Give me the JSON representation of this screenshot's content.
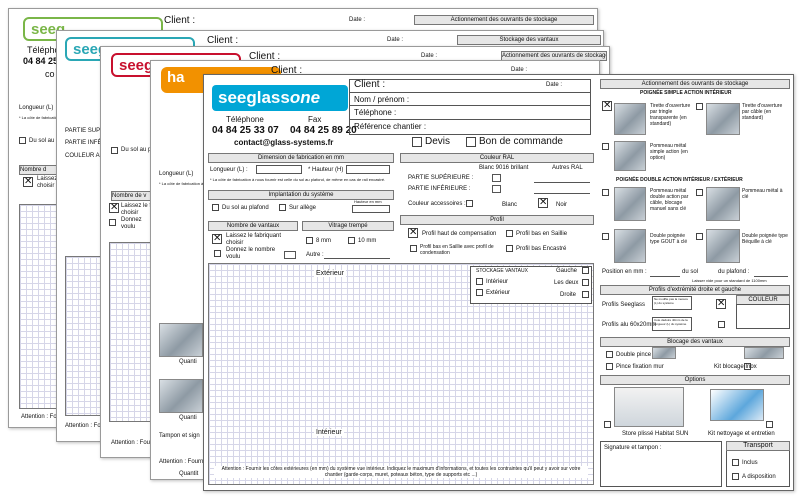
{
  "brand": {
    "name_a": "seeglass",
    "name_b": "ONE",
    "other_logo_1": "seeg",
    "other_logo_2": "seeg",
    "other_logo_3": "ha",
    "phone_label": "Téléphone",
    "phone": "04 84 25 33 07",
    "fax_label": "Fax",
    "fax": "04 84 25 89 20",
    "email": "contact@glass-systems.fr",
    "back_phone_label": "Téléph",
    "back_phone": "04 84 25 3",
    "back_contact": "contact",
    "back_phone_label_2": "Téléphon",
    "back_phone_2": "04 84 25 33",
    "back_contact_2": "contact@",
    "back_phone_label_3": "Télépho",
    "back_phone_3": "04 84 25 33",
    "back_contact_3": "conta",
    "back_phone_label_4": "Téléphon",
    "back_phone_4": "04 84 25 33",
    "back_contact_4": "contact@g",
    "back_phone_label_5": "Téléphone",
    "back_phone_5": "04 84 25 33 0",
    "back_contact_5": "co"
  },
  "back_sheets": {
    "client": "Client :",
    "date": "Date :",
    "title_1": "Actionnement des ouvrants de stockage",
    "title_2": "Stockage des vantaux",
    "title_3": "Actionnement des ouvrants de stockage",
    "title_4": "Couleur RAL",
    "longueur": "Longueur (L)",
    "cote_note": "* La côte de fabrication à nous",
    "du_sol": "Du sol au pla",
    "nombre": "Nombre d",
    "laissez": "Laissez le fabri",
    "choisir": "choisir",
    "attention": "Attention : Fo",
    "partie_sup": "PARTIE SUPÉ",
    "partie_inf": "PARTIE INFÉRI",
    "couleur_ac": "COULEUR AC",
    "du_sol_2": "Du sol au pl",
    "du": "Du",
    "longueur_2": "Longueur (L)",
    "cote_note_2": "* La côte de fabrication à nous",
    "nombre_2": "Nombre de v",
    "laissez_2": "Laissez le fab",
    "choisir_2": "choisir",
    "donnez": "Donnez",
    "voulu": "voulu",
    "attention_2": "Attention : Fo",
    "longueur_3": "Longueur (L)",
    "quanti": "Quanti",
    "attention_3": "Attention : Fourni",
    "quanti_2": "Quanti",
    "tampon": "Tampon et sign",
    "attention_4": "Attention : Fourn",
    "quantit": "Quantit"
  },
  "header": {
    "client": "Client :",
    "date": "Date :",
    "nom": "Nom / prénom :",
    "telephone": "Téléphone :",
    "reference": "Référence chantier :",
    "devis": "Devis",
    "bon": "Bon de commande"
  },
  "dimension": {
    "title": "Dimension de fabrication en mm",
    "longueur": "Longueur (L) :",
    "hauteur": "* Hauteur (H)",
    "note": "* La côte de fabrication à nous fournir est celle du sol au plafond, de même en cas de rail encastré."
  },
  "implantation": {
    "title": "Implantation du système",
    "sol_plafond": "Du sol au plafond",
    "allege": "Sur allège",
    "hauteur_allege": "Hauteur en mm"
  },
  "vantaux": {
    "title": "Nombre de vantaux",
    "laissez": "Laissez le fabriquant choisir",
    "donnez": "Donnez le nombre voulu"
  },
  "vitrage": {
    "title": "Vitrage trempé",
    "opt1": "8 mm",
    "opt2": "10 mm",
    "autre": "Autre :"
  },
  "couleur": {
    "title": "Couleur RAL",
    "blanc9016": "Blanc 9016 brillant",
    "autres": "Autres RAL",
    "partie_sup": "PARTIE SUPÉRIEURE :",
    "partie_inf": "PARTIE INFÉRIEURE :",
    "accessoires": "Couleur accessoires :",
    "blanc": "Blanc",
    "noir": "Noir"
  },
  "profil": {
    "title": "Profil",
    "haut_comp": "Profil haut de compensation",
    "bas_saillie": "Profil bas en Saillie",
    "bas_saillie_cond": "Profil bas en Saillie avec profil de condensation",
    "bas_encastre": "Profil bas Encastré"
  },
  "drawing": {
    "exterieur": "Extérieur",
    "interieur": "Intérieur",
    "stockage_title": "STOCKAGE VANTAUX",
    "stock_int": "Intérieur",
    "stock_ext": "Extérieur",
    "gauche": "Gauche",
    "les_deux": "Les deux",
    "droite": "Droite",
    "attention": "Attention : Fournir les côtes extérieures (en mm) du système vue intérieur. Indiquez le maximum d'informations, et toutes les contraintes qu'il peut y avoir sur votre chantier (garde-corps, muret, poteaux béton, type de supports etc ...)"
  },
  "right": {
    "actionnement_title": "Actionnement des ouvrants de stockage",
    "poignee_simple": "POIGNÉE SIMPLE ACTION INTÉRIEUR",
    "tirette_1": "Tirette d'ouverture par tringle transparente (en standard)",
    "tirette_2": "Tirette d'ouverture par câble (en standard)",
    "pommeau_1": "Pommeau métal simple action (en option)",
    "poignee_double": "POIGNÉE DOUBLE ACTION INTÉRIEUR / EXTÉRIEUR",
    "pommeau_2": "Pommeau métal double action par câble, blocage manuel sans clé",
    "pommeau_3": "Pommeau métal à clé",
    "double_poignee_1": "Double poignée type GOUT à clé",
    "double_poignee_2": "Double poignée type Béquille à clé",
    "position": "Position en mm :",
    "du_sol": "du sol",
    "du_plafond": "du plafond :",
    "position_note": "Laisser vide pour un standard de 1100mm",
    "extremite_title": "Profils d'extrémité droite et gauche",
    "profils_seeglass": "Profils Seeglass",
    "ne_modifie": "Ne modifie pas la mesure (L) du système",
    "couleur": "COULEUR",
    "profils_alu": "Profils alu 60x20mm",
    "cote_deduire": "Cote déduire 40mm de la longueur (L) du système",
    "blocage_title": "Blocage des vantaux",
    "double_pince": "Double pince",
    "pince_mur": "Pince fixation mur",
    "kit_inox": "Kit blocage Inox",
    "options_title": "Options",
    "store": "Store plissé Habitat SUN",
    "kit_nettoyage": "Kit nettoyage et entretien",
    "signature": "Signature et tampon :",
    "transport": "Transport",
    "inclus": "Inclus",
    "a_disposition": "A disposition"
  },
  "colors": {
    "seeglass_blue": "#00a6d6",
    "orange": "#f29100",
    "green": "#7ab648",
    "teal": "#2aa7b5",
    "red": "#c8102e",
    "header_grey": "#e6e6e6"
  }
}
